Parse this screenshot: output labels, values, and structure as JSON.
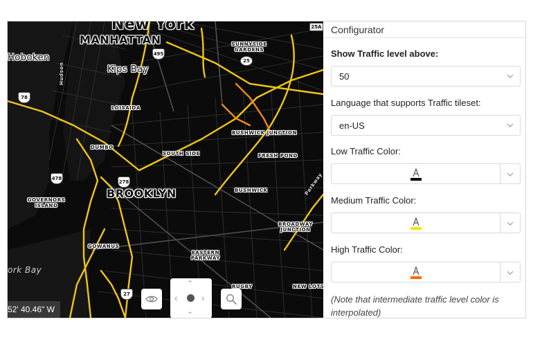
{
  "map": {
    "labels": {
      "new_york": "New York",
      "manhattan": "MANHATTAN",
      "hoboken": "Hoboken",
      "kips_bay": "Kips Bay",
      "loisaida": "LOISAIDA",
      "sunnyside_gardens": "SUNNYSIDE GARDENS",
      "bushwick_junction": "BUSHWICK JUNCTION",
      "south_side": "SOUTH SIDE",
      "fresh_pond": "FRESH POND",
      "dumbo": "DUMBO",
      "brooklyn": "BROOKLYN",
      "bushwick": "BUSHWICK",
      "governors_island": "GOVERNORS ISLAND",
      "broadway_junction": "BROADWAY JUNCTION",
      "gowanus": "GOWANUS",
      "eastern_parkway": "EASTERN PARKWAY",
      "york_bay": "ork Bay",
      "rugby": "RUGBY",
      "new_lots": "NEW LOTS",
      "parkway_vertical": "Parkway",
      "hudson_vertical": "Hudson"
    },
    "shields": {
      "s25a": "25A",
      "s495": "495",
      "s25": "25",
      "s78": "78",
      "s478": "478",
      "s278": "278",
      "s27": "27"
    },
    "coordinates": "52' 40.46\" W"
  },
  "panel": {
    "title": "Configurator",
    "traffic_level_label": "Show Traffic level above:",
    "traffic_level_value": "50",
    "language_label": "Language that supports Traffic tileset:",
    "language_value": "en-US",
    "low_color_label": "Low Traffic Color:",
    "low_color": "#000000",
    "medium_color_label": "Medium Traffic Color:",
    "medium_color": "#f2e600",
    "high_color_label": "High Traffic Color:",
    "high_color": "#ff6a00",
    "note": "(Note that intermediate traffic level color is interpolated)"
  },
  "colors": {
    "traffic_yellow": "#f2c518",
    "traffic_orange": "#f08a1c",
    "road": "#3a3a3a"
  }
}
